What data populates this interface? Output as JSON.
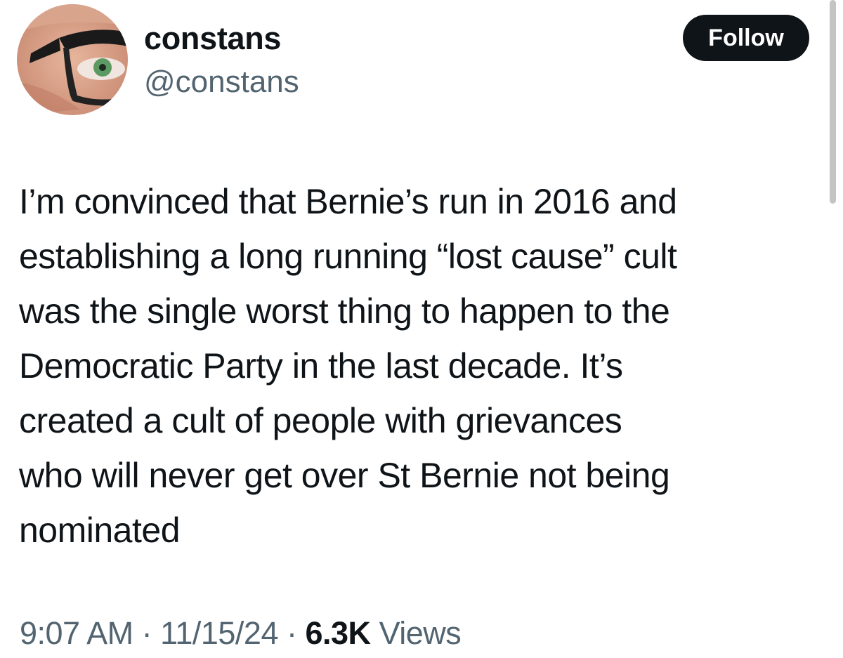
{
  "author": {
    "display_name": "constans",
    "handle": "@constans"
  },
  "follow_button": {
    "label": "Follow"
  },
  "tweet": {
    "lines": [
      "I’m convinced that Bernie’s run in 2016 and",
      "establishing a long running “lost cause” cult",
      "was the single worst thing to happen to the",
      "Democratic Party in the last decade. It’s",
      "created a cult of people with grievances",
      "who will never get over St Bernie not being",
      "nominated"
    ]
  },
  "meta": {
    "time": "9:07 AM",
    "separator": "·",
    "date": "11/15/24",
    "views_count": "6.3K",
    "views_label": "Views"
  },
  "colors": {
    "text_primary": "#0f1419",
    "text_secondary": "#536471",
    "follow_button_bg": "#0f1419",
    "follow_button_text": "#ffffff"
  }
}
